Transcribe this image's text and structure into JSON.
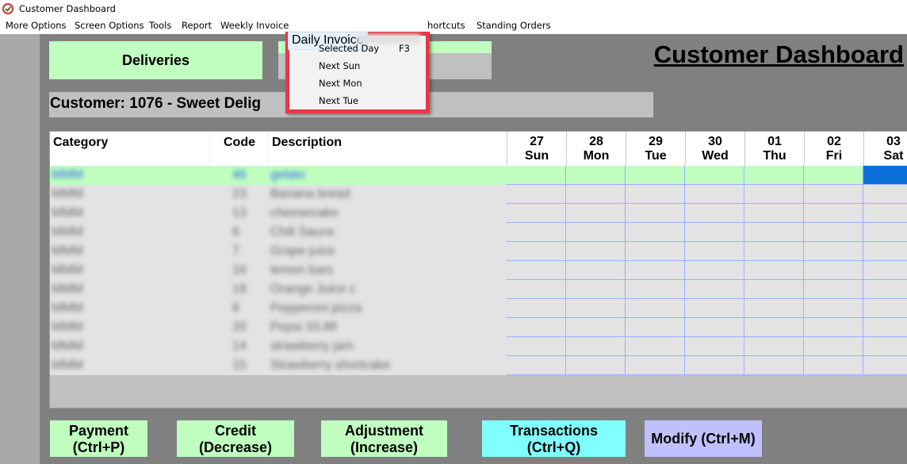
{
  "window": {
    "title": "Customer Dashboard"
  },
  "menubar": {
    "items": [
      "More Options",
      "Screen Options",
      "Tools",
      "Report",
      "Weekly Invoice",
      "Daily Invoice",
      "",
      "Shortcuts",
      "Standing Orders"
    ],
    "active": "Daily Invoice",
    "shortcuts_partial": "hortcuts"
  },
  "dropdown": {
    "items": [
      {
        "label": "Selected Day",
        "shortcut": "F3"
      },
      {
        "label": "Next Sun",
        "shortcut": ""
      },
      {
        "label": "Next Mon",
        "shortcut": ""
      },
      {
        "label": "Next Tue",
        "shortcut": ""
      }
    ]
  },
  "tabs": {
    "deliveries": "Deliveries",
    "other": ""
  },
  "header": {
    "title": "Customer Dashboard"
  },
  "customer": {
    "label": "Customer: 1076 - Sweet Delig"
  },
  "grid": {
    "columns": {
      "category": "Category",
      "code": "Code",
      "description": "Description"
    },
    "days": [
      {
        "date": "27",
        "day": "Sun"
      },
      {
        "date": "28",
        "day": "Mon"
      },
      {
        "date": "29",
        "day": "Tue"
      },
      {
        "date": "30",
        "day": "Wed"
      },
      {
        "date": "01",
        "day": "Thu"
      },
      {
        "date": "02",
        "day": "Fri"
      },
      {
        "date": "03",
        "day": "Sat"
      }
    ],
    "rows": [
      {
        "category": "MMM",
        "code": "46",
        "description": "gelato"
      },
      {
        "category": "MMM",
        "code": "23",
        "description": "Banana bread"
      },
      {
        "category": "MMM",
        "code": "13",
        "description": "cheesecake"
      },
      {
        "category": "MMM",
        "code": "6",
        "description": "Chili Sauce"
      },
      {
        "category": "MMM",
        "code": "7",
        "description": "Grape juice"
      },
      {
        "category": "MMM",
        "code": "16",
        "description": "lemon bars"
      },
      {
        "category": "MMM",
        "code": "18",
        "description": "Orange Juice c"
      },
      {
        "category": "MMM",
        "code": "8",
        "description": "Pepperoni pizza"
      },
      {
        "category": "MMM",
        "code": "20",
        "description": "Pepsi 33.8fl"
      },
      {
        "category": "MMM",
        "code": "14",
        "description": "strawberry jam"
      },
      {
        "category": "MMM",
        "code": "15",
        "description": "Strawberry shortcake"
      }
    ]
  },
  "buttons": {
    "payment": [
      "Payment",
      "(Ctrl+P)"
    ],
    "credit": [
      "Credit",
      "(Decrease)"
    ],
    "adjustment": [
      "Adjustment",
      "(Increase)"
    ],
    "transactions": [
      "Transactions",
      "(Ctrl+Q)"
    ],
    "modify": "Modify (Ctrl+M)"
  },
  "colors": {
    "highlight_border": "#e63946",
    "green": "#c0ffc0",
    "cyan": "#80ffff",
    "purple": "#c0c0ff",
    "selected_cell": "#0a6fd8"
  }
}
